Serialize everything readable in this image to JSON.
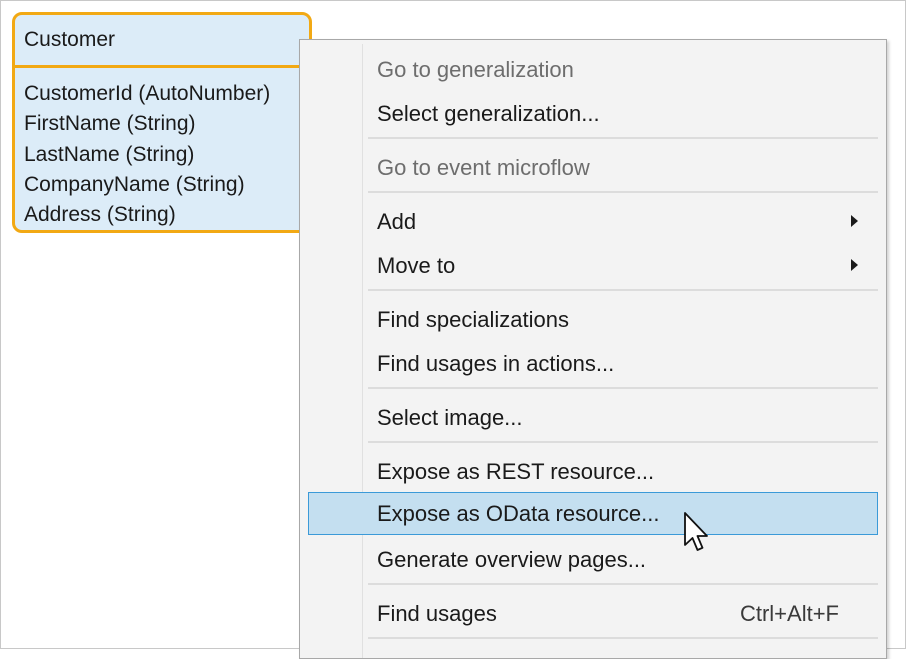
{
  "entity": {
    "title": "Customer",
    "attributes": [
      "CustomerId (AutoNumber)",
      "FirstName (String)",
      "LastName (String)",
      "CompanyName (String)",
      "Address (String)"
    ],
    "border_color": "#f2a914",
    "fill_color": "#dcecf8"
  },
  "menu": {
    "go_to_generalization": "Go to generalization",
    "select_generalization": "Select generalization...",
    "go_to_event_microflow": "Go to event microflow",
    "add": "Add",
    "move_to": "Move to",
    "find_specializations": "Find specializations",
    "find_usages_in_actions": "Find usages in actions...",
    "select_image": "Select image...",
    "expose_rest": "Expose as REST resource...",
    "expose_odata": "Expose as OData resource...",
    "generate_overview": "Generate overview pages...",
    "find_usages": "Find usages",
    "find_usages_shortcut": "Ctrl+Alt+F",
    "highlight_color": "#c4dff0",
    "highlight_border": "#3b9ad8"
  },
  "cursor": {
    "icon": "arrow-pointer-icon"
  }
}
